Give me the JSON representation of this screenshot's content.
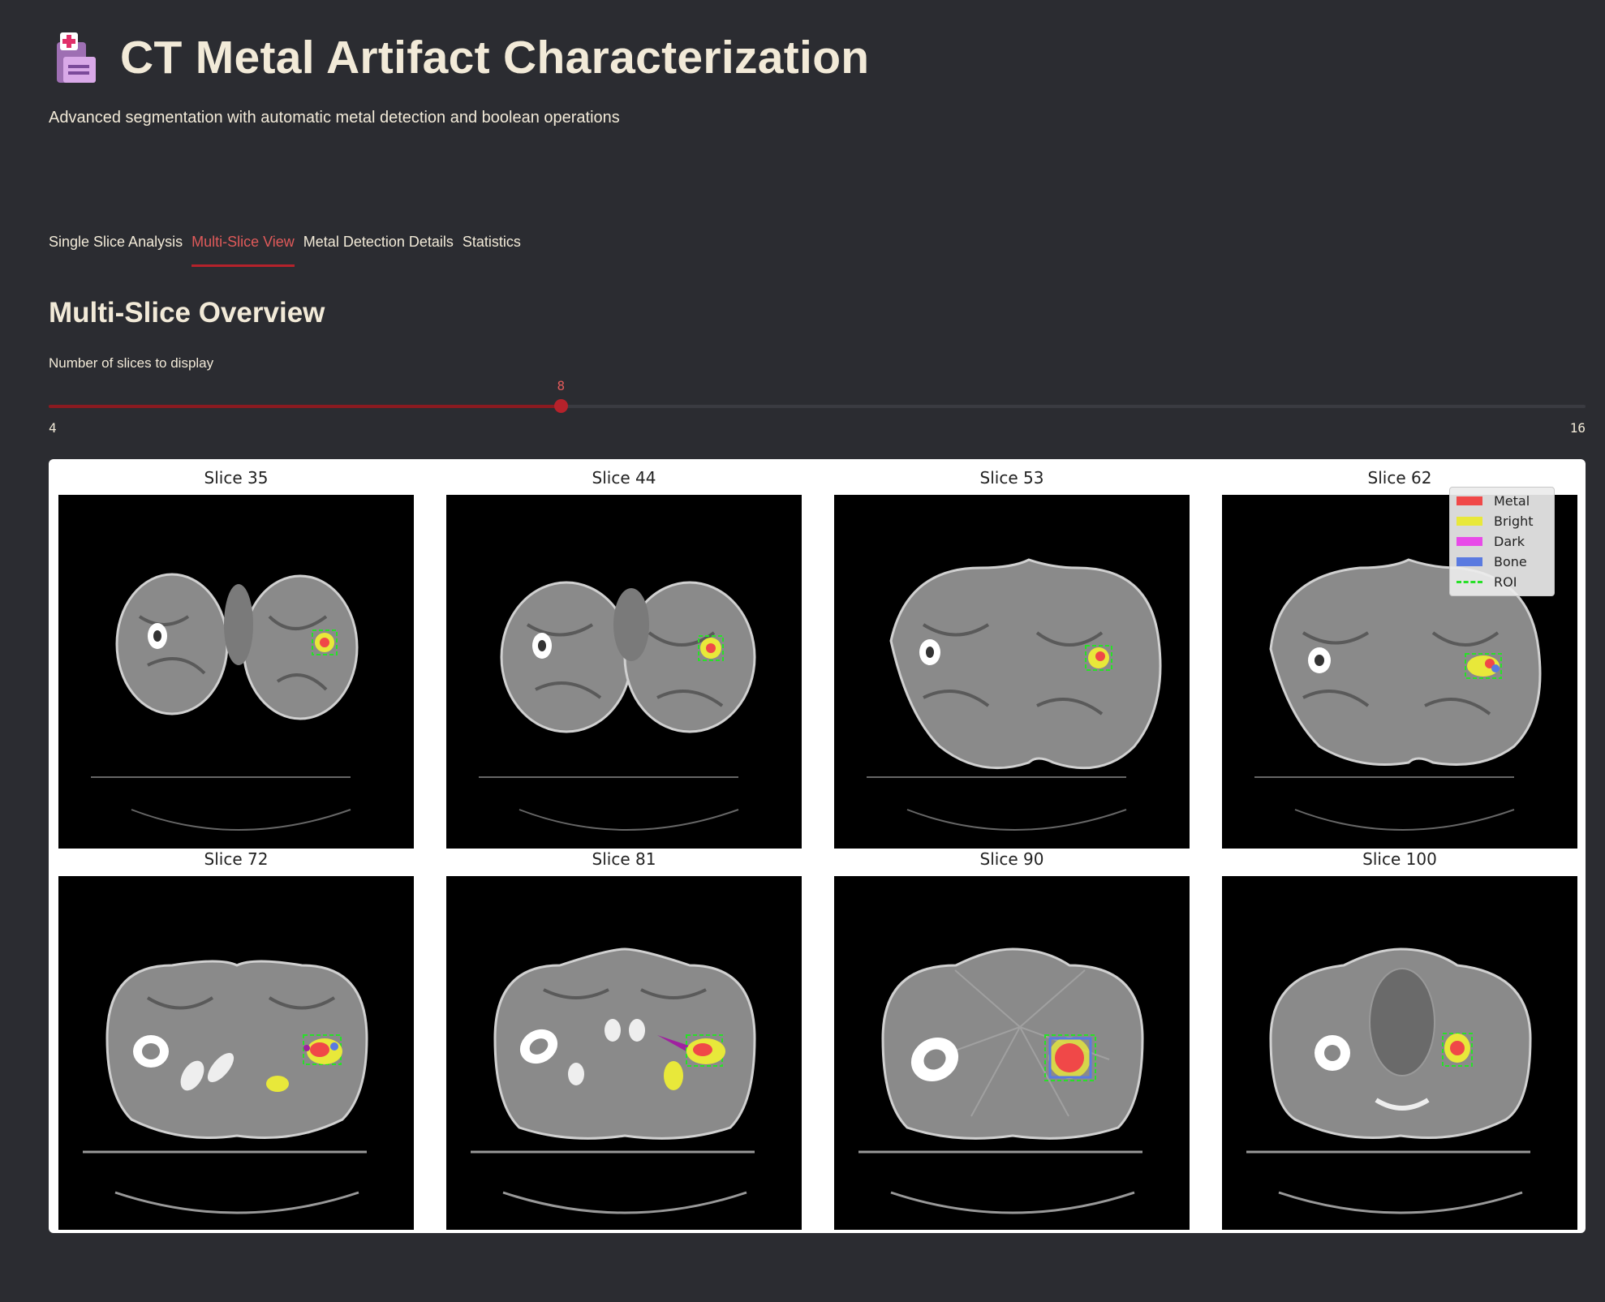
{
  "header": {
    "icon_name": "hospital-icon",
    "title": "CT Metal Artifact Characterization",
    "subtitle": "Advanced segmentation with automatic metal detection and boolean operations"
  },
  "tabs": [
    {
      "label": "Single Slice Analysis",
      "active": false
    },
    {
      "label": "Multi-Slice View",
      "active": true
    },
    {
      "label": "Metal Detection Details",
      "active": false
    },
    {
      "label": "Statistics",
      "active": false
    }
  ],
  "section": {
    "title": "Multi-Slice Overview",
    "slider": {
      "label": "Number of slices to display",
      "value": 8,
      "min": 4,
      "max": 16,
      "value_text": "8",
      "min_text": "4",
      "max_text": "16"
    }
  },
  "figure": {
    "panels": [
      "Slice 35",
      "Slice 44",
      "Slice 53",
      "Slice 62",
      "Slice 72",
      "Slice 81",
      "Slice 90",
      "Slice 100"
    ],
    "legend": [
      {
        "label": "Metal",
        "color": "#f04848"
      },
      {
        "label": "Bright",
        "color": "#e8e83a"
      },
      {
        "label": "Dark",
        "color": "#e84ae8"
      },
      {
        "label": "Bone",
        "color": "#5a7ae0"
      },
      {
        "label": "ROI",
        "color": "#28e028"
      }
    ]
  },
  "colors": {
    "background": "#2b2c31",
    "accent": "#b5222b",
    "text": "#f2ead8"
  }
}
